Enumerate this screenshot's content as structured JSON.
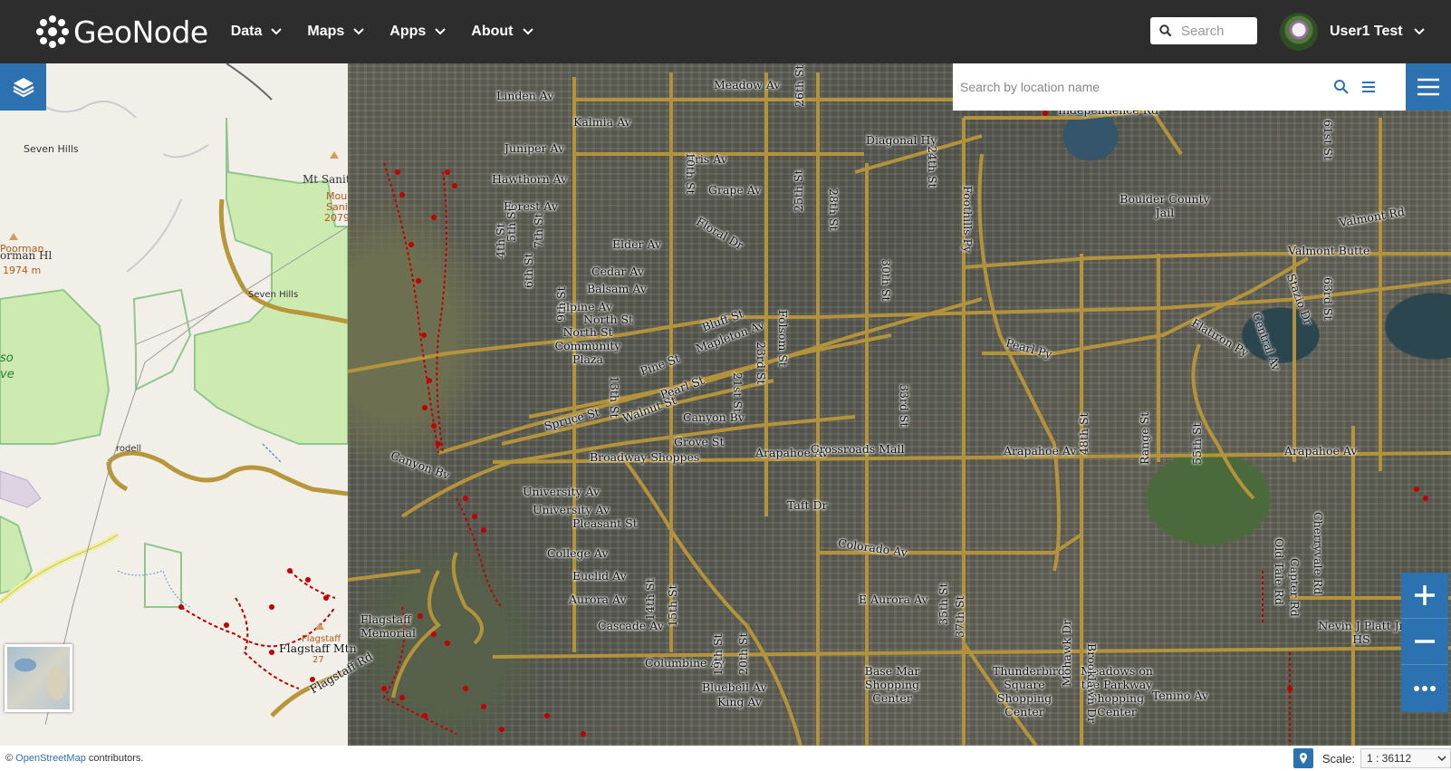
{
  "navbar": {
    "brand": "GeoNode",
    "menu": [
      {
        "label": "Data"
      },
      {
        "label": "Maps"
      },
      {
        "label": "Apps"
      },
      {
        "label": "About"
      }
    ],
    "search_placeholder": "Search",
    "user_name": "User1 Test"
  },
  "map": {
    "location_search_placeholder": "Search by location name",
    "osm_labels": {
      "seven_hills_1": "Seven Hills",
      "mt_sanitas": "Mt Sanitas",
      "mount": "Moun",
      "sani": "Sani",
      "elev_2079": "2079",
      "poorman": "Poorman",
      "orman_hl": "orman Hl",
      "elev_1974": "1974 m",
      "seven_hills_2": "Seven Hills",
      "so": "so",
      "ve": "ve",
      "rodell": "rodell",
      "flagstaff_small": "Flagstaff",
      "elev_27": "27"
    },
    "labels": [
      "Linden Av",
      "Meadow Av",
      "Kalmia Av",
      "Juniper Av",
      "Hawthorn Av",
      "Forest Av",
      "Iris Av",
      "Grape Av",
      "Diagonal Hy",
      "Elder Av",
      "Floral Dr",
      "Cedar Av",
      "Balsam Av",
      "Alpine Av",
      "North St",
      "Bluff St",
      "Mapleton Av",
      "Pine St",
      "Walnut St",
      "Canyon Bv",
      "Canyon Bv",
      "Grove St",
      "Arapahoe Av",
      "Arapahoe Av",
      "Arapahoe Av",
      "Broadway Shoppes",
      "Marine St",
      "University Av",
      "Pleasant St",
      "College Av",
      "Euclid Av",
      "Aurora Av",
      "Cascade Av",
      "Columbine Av",
      "Bluebell Av",
      "King Av",
      "Colorado Av",
      "E Aurora Av",
      "Pearl Py",
      "Flatiron Py",
      "Valmont Rd",
      "Valmont Butte",
      "Boulder County Jail",
      "Independence Rd",
      "Taft Dr",
      "Flagstaff Memorial",
      "Flagstaff Mtn",
      "Flagstaff Rd",
      "Nevin J Platt Jr HS",
      "Base Mar Shopping Center",
      "Thunderbird Square Shopping Center",
      "Meadows on the Parkway Shopping Center",
      "Tenino Av",
      "Mohawk Dr",
      "Brooklawn Dr",
      "Foothills Py",
      "28th St",
      "30th St",
      "Folsom St",
      "Range St",
      "55th St",
      "Cherryvale Rd",
      "Capter Rd",
      "4th St",
      "5th St",
      "6th St",
      "7th St",
      "9th St",
      "10th St",
      "13th St",
      "14th St",
      "15th St",
      "19th St",
      "20th St",
      "21st St",
      "23rd St",
      "24th St",
      "25th St",
      "26th St",
      "33rd St",
      "35th St",
      "37th St",
      "48th St",
      "61st St",
      "63rd St",
      "Stazio Dr",
      "Central Av",
      "Old Tale Rd",
      "Pearl St",
      "Spruce St",
      "Crossroads Mall",
      "Central Av",
      "North St Community Plaza"
    ]
  },
  "footer": {
    "attribution_prefix": "© ",
    "attribution_link": "OpenStreetMap",
    "attribution_suffix": " contributors.",
    "scale_label": "Scale:",
    "scale_value": "1 : 36112"
  },
  "colors": {
    "navbar_bg": "#2d2d2d",
    "accent": "#2c72b1",
    "road": "#b8963a",
    "trail": "#c00000"
  }
}
